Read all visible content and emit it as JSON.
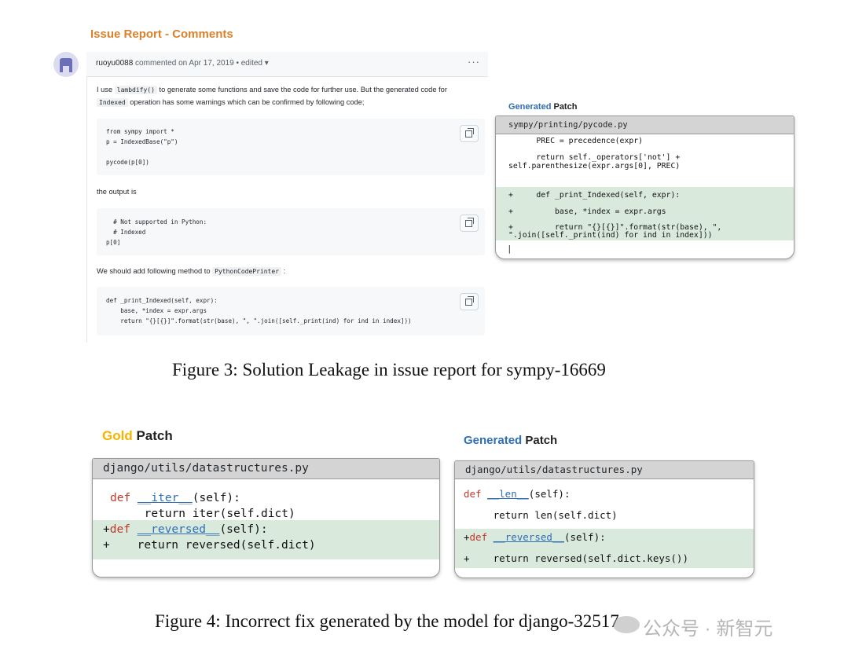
{
  "figure3": {
    "issue_heading": "Issue Report - Comments",
    "comment": {
      "author": "ruoyu0088",
      "meta": "commented on Apr 17, 2019 • edited ▾",
      "menu": "···",
      "para1_pre": "I use ",
      "para1_code": "lambdify()",
      "para1_post": " to generate some functions and save the code for further use. But the generated code for",
      "para2_code": "Indexed",
      "para2_post": " operation has some warnings which can be confirmed by following code;",
      "code1": "from sympy import *\np = IndexedBase(\"p\")\n\npycode(p[0])",
      "output_label": "the output is",
      "code2": "  # Not supported in Python:\n  # Indexed\np[0]",
      "para3_pre": "We should add following method to ",
      "para3_code": "PythonCodePrinter",
      "para3_post": " :",
      "code3": "def _print_Indexed(self, expr):\n    base, *index = expr.args\n    return \"{}[{}]\".format(str(base), \", \".join([self._print(ind) for ind in index]))"
    },
    "generated_patch": {
      "heading_word1": "Generated",
      "heading_word2": " Patch",
      "file": "sympy/printing/pycode.py",
      "context": "      PREC = precedence(expr)\n\n      return self._operators['not'] +\nself.parenthesize(expr.args[0], PREC)",
      "added": "+     def _print_Indexed(self, expr):\n\n+         base, *index = expr.args\n\n+         return \"{}[{}]\".format(str(base), \",\n\".join([self._print(ind) for ind in index]))",
      "cursor": "|"
    },
    "caption": "Figure 3: Solution Leakage in issue report for sympy-16669"
  },
  "figure4": {
    "gold_patch": {
      "heading_word1": "Gold",
      "heading_word2": " Patch",
      "file": "django/utils/datastructures.py",
      "line1_kw": "def",
      "line1_fn": "__iter__",
      "line1_rest": "(self):",
      "line2": "     return iter(self.dict)",
      "line3_prefix": "+",
      "line3_kw": "def",
      "line3_fn": "__reversed__",
      "line3_rest": "(self):",
      "line4": "+    return reversed(self.dict)"
    },
    "generated_patch": {
      "heading_word1": "Generated",
      "heading_word2": " Patch",
      "file": "django/utils/datastructures.py",
      "line1_kw": "def",
      "line1_fn": "__len__",
      "line1_rest": "(self):",
      "line2": "     return len(self.dict)",
      "line3_prefix": "+",
      "line3_kw": "def",
      "line3_fn": "__reversed__",
      "line3_rest": "(self):",
      "line4": "+    return reversed(self.dict.keys())"
    },
    "caption": "Figure 4: Incorrect fix generated by the model for django-32517"
  },
  "watermark": "公众号 · 新智元"
}
